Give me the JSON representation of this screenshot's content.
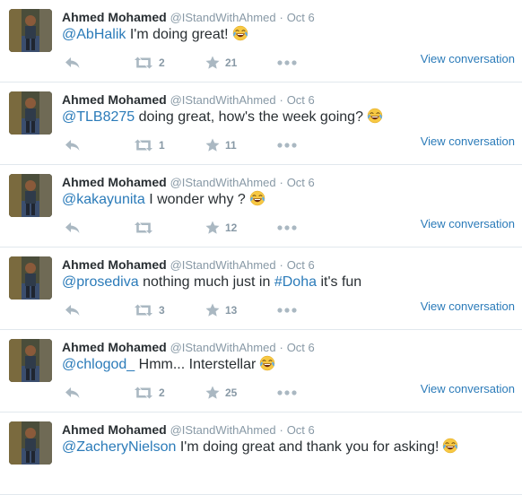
{
  "tweets": [
    {
      "fullname": "Ahmed Mohamed",
      "username": "@IStandWithAhmed",
      "separator": "·",
      "time": "Oct 6",
      "mention": "@AbHalik",
      "text": "I'm doing great!",
      "hashtag": "",
      "text_after": "",
      "retweets": "2",
      "favorites": "21",
      "view_conversation": "View conversation"
    },
    {
      "fullname": "Ahmed Mohamed",
      "username": "@IStandWithAhmed",
      "separator": "·",
      "time": "Oct 6",
      "mention": "@TLB8275",
      "text": "doing great, how's the week going?",
      "hashtag": "",
      "text_after": "",
      "retweets": "1",
      "favorites": "11",
      "view_conversation": "View conversation"
    },
    {
      "fullname": "Ahmed Mohamed",
      "username": "@IStandWithAhmed",
      "separator": "·",
      "time": "Oct 6",
      "mention": "@kakayunita",
      "text": "I wonder why ?",
      "hashtag": "",
      "text_after": "",
      "retweets": "",
      "favorites": "12",
      "view_conversation": "View conversation"
    },
    {
      "fullname": "Ahmed Mohamed",
      "username": "@IStandWithAhmed",
      "separator": "·",
      "time": "Oct 6",
      "mention": "@prosediva",
      "text": "nothing much just in",
      "hashtag": "#Doha",
      "text_after": "it's fun",
      "retweets": "3",
      "favorites": "13",
      "view_conversation": "View conversation"
    },
    {
      "fullname": "Ahmed Mohamed",
      "username": "@IStandWithAhmed",
      "separator": "·",
      "time": "Oct 6",
      "mention": "@chlogod_",
      "text": "Hmm... Interstellar",
      "hashtag": "",
      "text_after": "",
      "retweets": "2",
      "favorites": "25",
      "view_conversation": "View conversation"
    },
    {
      "fullname": "Ahmed Mohamed",
      "username": "@IStandWithAhmed",
      "separator": "·",
      "time": "Oct 6",
      "mention": "@ZacheryNielson",
      "text": "I'm doing great and thank you for asking!",
      "hashtag": "",
      "text_after": "",
      "retweets": "",
      "favorites": "",
      "view_conversation": ""
    }
  ],
  "icons": {
    "reply": "reply-arrow-icon",
    "retweet": "retweet-icon",
    "favorite": "star-icon",
    "more": "more-dots-icon",
    "emoji": "tears-of-joy-emoji-icon"
  },
  "colors": {
    "link": "#2b7bb9",
    "meta": "#8899a6",
    "icon": "#aab8c2",
    "divider": "#e1e8ed"
  }
}
